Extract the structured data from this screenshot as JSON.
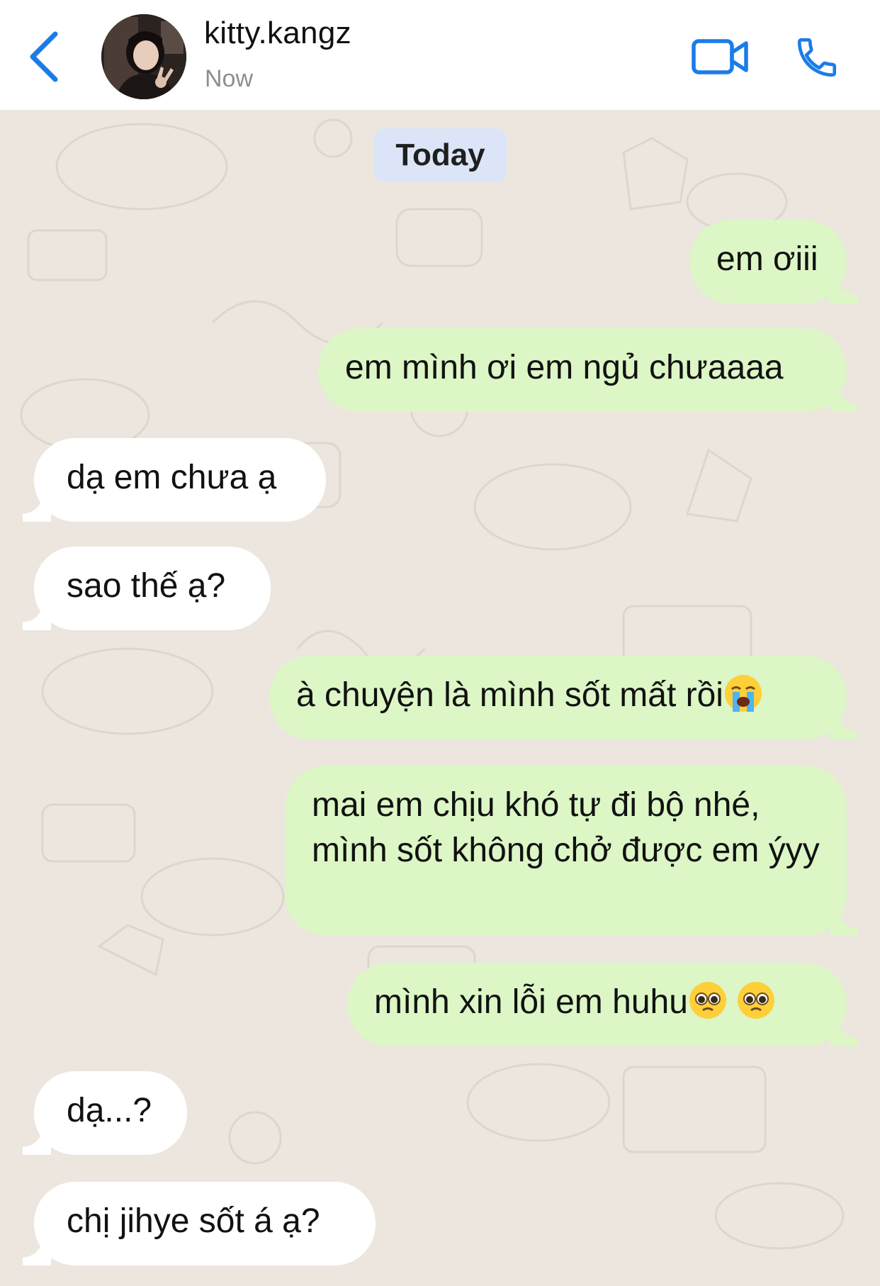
{
  "header": {
    "contact_name": "kitty.kangz",
    "status": "Now",
    "back_icon": "chevron-left-icon",
    "video_icon": "video-camera-icon",
    "call_icon": "phone-icon",
    "accent_color": "#1b7ce8"
  },
  "chat": {
    "date_label": "Today",
    "messages": [
      {
        "direction": "outgoing",
        "text": "em ơiii"
      },
      {
        "direction": "outgoing",
        "text": "em mình ơi em ngủ chưaaaa"
      },
      {
        "direction": "incoming",
        "text": "dạ em chưa ạ"
      },
      {
        "direction": "incoming",
        "text": "sao thế ạ?"
      },
      {
        "direction": "outgoing",
        "text": "à chuyện là mình sốt mất rồi",
        "emoji": [
          "loudly-crying-face"
        ]
      },
      {
        "direction": "outgoing",
        "text": "mai em chịu khó tự đi bộ nhé, mình sốt không chở được em ýyy"
      },
      {
        "direction": "outgoing",
        "text": "mình xin lỗi em huhu",
        "emoji": [
          "pleading-face",
          "pleading-face"
        ]
      },
      {
        "direction": "incoming",
        "text": "dạ...?"
      },
      {
        "direction": "incoming",
        "text": "chị jihye sốt á ạ?"
      }
    ],
    "colors": {
      "outgoing_bubble": "#dcf6c6",
      "incoming_bubble": "#ffffff",
      "date_chip": "#dbe5f7",
      "wallpaper": "#ece6df"
    }
  }
}
